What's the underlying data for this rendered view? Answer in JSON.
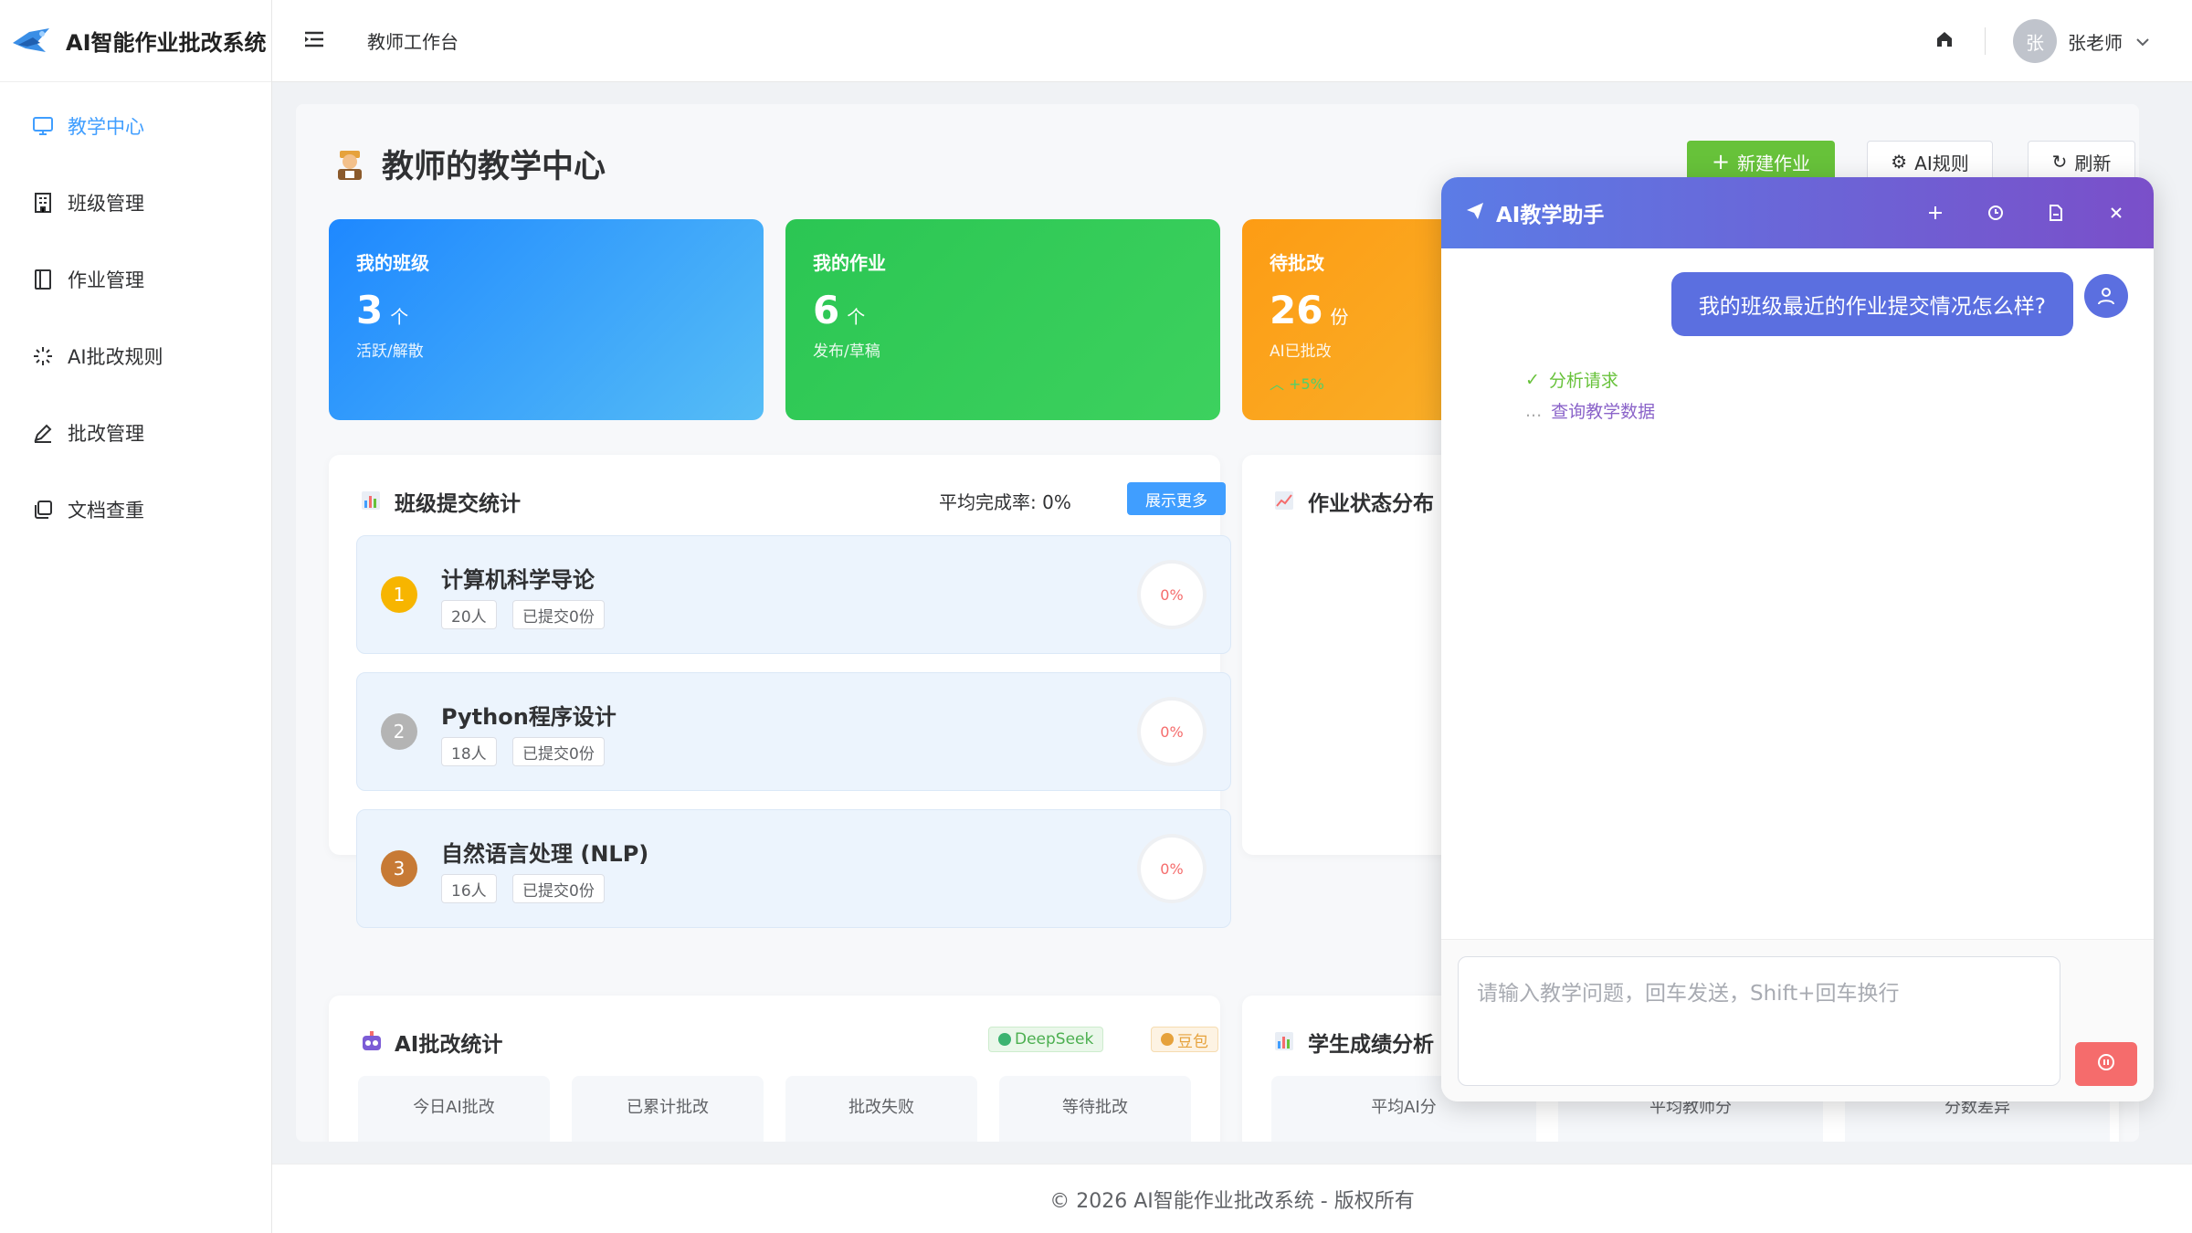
{
  "app": {
    "title": "AI智能作业批改系统"
  },
  "sidebar": {
    "items": [
      {
        "label": "教学中心",
        "icon": "monitor-icon",
        "active": true
      },
      {
        "label": "班级管理",
        "icon": "building-icon"
      },
      {
        "label": "作业管理",
        "icon": "notebook-icon"
      },
      {
        "label": "AI批改规则",
        "icon": "loading-icon"
      },
      {
        "label": "批改管理",
        "icon": "edit-pen-icon"
      },
      {
        "label": "文档查重",
        "icon": "copy-document-icon"
      }
    ]
  },
  "header": {
    "breadcrumb": "教师工作台",
    "avatar_initial": "张",
    "username": "张老师"
  },
  "page": {
    "title": "教师的教学中心",
    "buttons": {
      "new": "新建作业",
      "rules": "AI规则",
      "refresh": "刷新"
    }
  },
  "stats": [
    {
      "title": "我的班级",
      "value": "3",
      "unit": "个",
      "sub": "活跃/解散",
      "color": "#1e90ff"
    },
    {
      "title": "我的作业",
      "value": "6",
      "unit": "个",
      "sub": "发布/草稿",
      "color": "#2ecc5a"
    },
    {
      "title": "待批改",
      "value": "26",
      "unit": "份",
      "sub": "AI已批改",
      "trend": "+5%",
      "color": "#fb9e1b"
    }
  ],
  "class_stats": {
    "title": "班级提交统计",
    "avg_label": "平均完成率: 0%",
    "more": "展示更多",
    "rows": [
      {
        "rank": "1",
        "name": "计算机科学导论",
        "people": "20人",
        "submitted": "已提交0份",
        "pct": "0%"
      },
      {
        "rank": "2",
        "name": "Python程序设计",
        "people": "18人",
        "submitted": "已提交0份",
        "pct": "0%"
      },
      {
        "rank": "3",
        "name": "自然语言处理 (NLP)",
        "people": "16人",
        "submitted": "已提交0份",
        "pct": "0%"
      }
    ]
  },
  "status_panel": {
    "title": "作业状态分布"
  },
  "ai_stats": {
    "title": "AI批改统计",
    "badges": [
      "DeepSeek",
      "豆包"
    ],
    "items": [
      "今日AI批改",
      "已累计批改",
      "批改失败",
      "等待批改"
    ]
  },
  "score_panel": {
    "title": "学生成绩分析",
    "items": [
      "平均AI分",
      "平均教师分",
      "分数差异"
    ]
  },
  "footer": {
    "text": "© 2026 AI智能作业批改系统 - 版权所有"
  },
  "chat": {
    "title": "AI教学助手",
    "user_message": "我的班级最近的作业提交情况怎么样?",
    "steps": [
      {
        "mark": "✓",
        "label": "分析请求"
      },
      {
        "mark": "...",
        "label": "查询教学数据"
      }
    ],
    "placeholder": "请输入教学问题，回车发送，Shift+回车换行"
  }
}
